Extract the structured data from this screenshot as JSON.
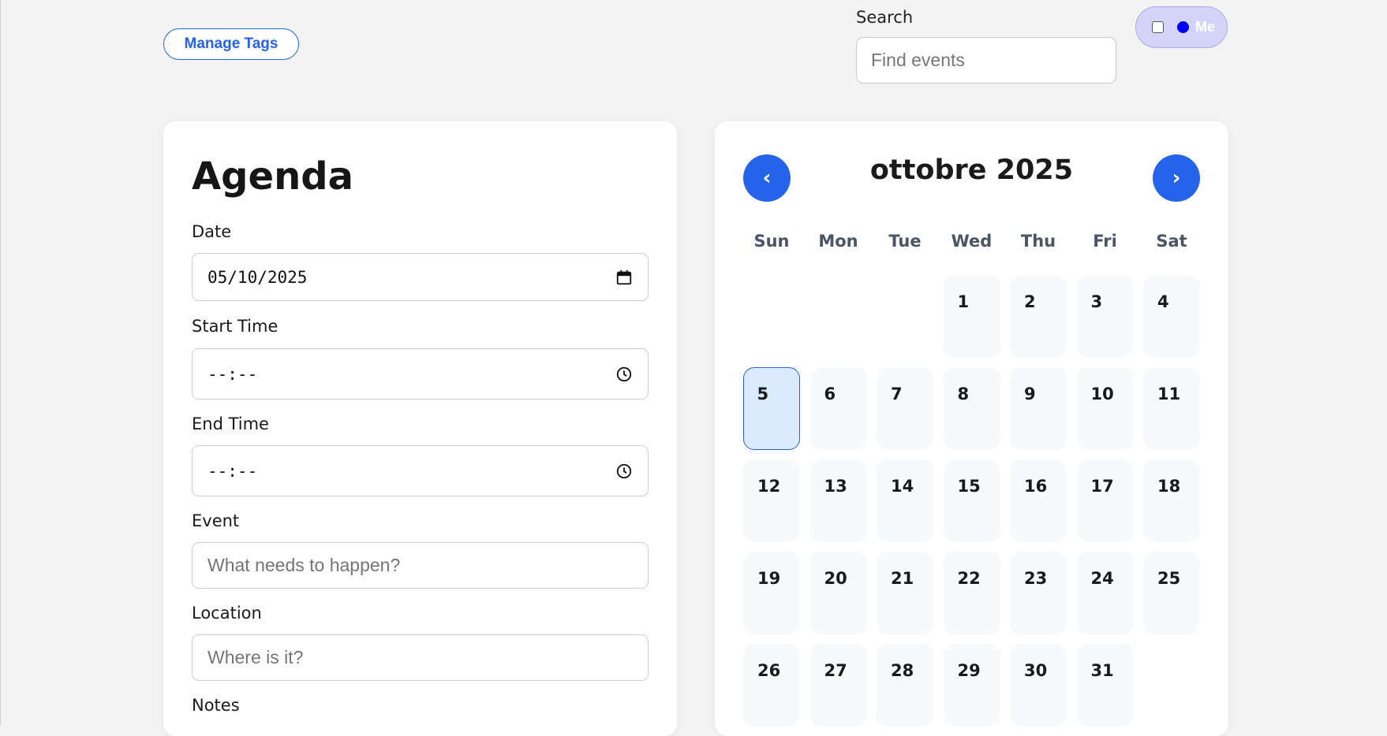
{
  "header": {
    "manage_tags_label": "Manage Tags",
    "search_label": "Search",
    "search_placeholder": "Find events",
    "me_label": "Me",
    "me_dot_color": "#0000ff"
  },
  "agenda": {
    "title": "Agenda",
    "date_label": "Date",
    "date_value": "05/10/2025",
    "start_label": "Start Time",
    "start_value": "--:--",
    "end_label": "End Time",
    "end_value": "--:--",
    "event_label": "Event",
    "event_placeholder": "What needs to happen?",
    "location_label": "Location",
    "location_placeholder": "Where is it?",
    "notes_label": "Notes"
  },
  "calendar": {
    "prev_label": "‹",
    "next_label": "›",
    "month_title": "ottobre 2025",
    "weekdays": [
      "Sun",
      "Mon",
      "Tue",
      "Wed",
      "Thu",
      "Fri",
      "Sat"
    ],
    "leading_blanks": 3,
    "days": [
      "1",
      "2",
      "3",
      "4",
      "5",
      "6",
      "7",
      "8",
      "9",
      "10",
      "11",
      "12",
      "13",
      "14",
      "15",
      "16",
      "17",
      "18",
      "19",
      "20",
      "21",
      "22",
      "23",
      "24",
      "25",
      "26",
      "27",
      "28",
      "29",
      "30",
      "31"
    ],
    "selected_day": "5",
    "accent_color": "#2563eb"
  }
}
